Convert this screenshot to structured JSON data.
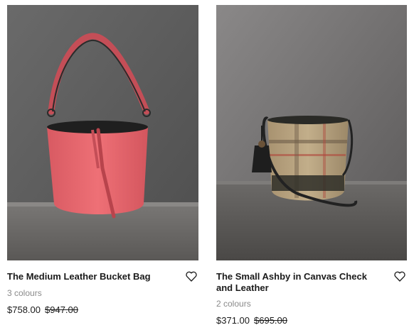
{
  "products": [
    {
      "title": "The Medium Leather Bucket Bag",
      "colours": "3 colours",
      "price": "$758.00",
      "was_price": "$947.00",
      "image": "pink-leather-bucket-bag-photo",
      "wishlist_icon": "heart-outline-icon"
    },
    {
      "title": "The Small Ashby in Canvas Check and Leather",
      "colours": "2 colours",
      "price": "$371.00",
      "was_price": "$695.00",
      "image": "check-canvas-bucket-bag-photo",
      "wishlist_icon": "heart-outline-icon"
    }
  ],
  "colors": {
    "text": "#1a1a1a",
    "muted": "#8a8a8a",
    "bag_pink": "#e8686e",
    "background_wall": "#5f5f5f"
  }
}
